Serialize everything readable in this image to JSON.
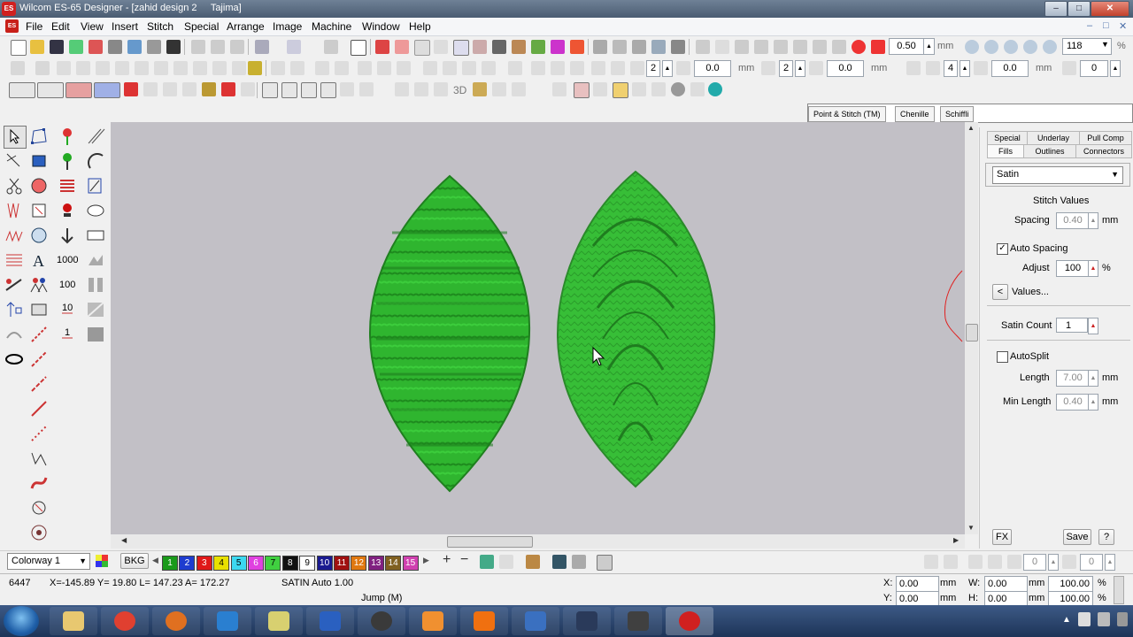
{
  "window": {
    "app_title": "Wilcom ES-65 Designer - [zahid design 2",
    "machine": "Tajima]",
    "logo": "ES"
  },
  "window_controls": [
    "–",
    "□",
    "✕"
  ],
  "mdi_controls": [
    "–",
    "□",
    "✕"
  ],
  "menu": {
    "items": [
      "File",
      "Edit",
      "View",
      "Insert",
      "Stitch",
      "Special",
      "Arrange",
      "Image",
      "Machine",
      "Window",
      "Help"
    ]
  },
  "toolbar": {
    "spacing_value": "0.50",
    "spacing_unit": "mm",
    "zoom_value": "118",
    "zoom_unit": "%",
    "row2": {
      "val_a": "2",
      "val_b": "0.0",
      "unit_b": "mm",
      "val_c": "2",
      "val_d": "0.0",
      "unit_d": "mm",
      "val_e": "4",
      "val_f": "0.0",
      "unit_f": "mm",
      "val_g": "0"
    },
    "row3_label": "3D"
  },
  "sub_tabs": [
    "Point & Stitch (TM)",
    "Chenille",
    "Schiffli"
  ],
  "toolbox": {
    "count_1000": "1000",
    "count_100": "100",
    "count_10": "10",
    "count_1": "1"
  },
  "properties": {
    "tabs_top": [
      "Special",
      "Underlay",
      "Pull Comp"
    ],
    "tabs_bottom": [
      "Fills",
      "Outlines",
      "Connectors"
    ],
    "fill_type": "Satin",
    "section_title": "Stitch Values",
    "spacing": {
      "label": "Spacing",
      "value": "0.40",
      "unit": "mm"
    },
    "auto_spacing": {
      "label": "Auto Spacing",
      "checked": true
    },
    "adjust": {
      "label": "Adjust",
      "value": "100",
      "unit": "%"
    },
    "values_button": {
      "arrow": "<",
      "label": "Values..."
    },
    "satin_count": {
      "label": "Satin Count",
      "value": "1"
    },
    "autosplit": {
      "label": "AutoSplit",
      "checked": false
    },
    "length": {
      "label": "Length",
      "value": "7.00",
      "unit": "mm"
    },
    "min_length": {
      "label": "Min Length",
      "value": "0.40",
      "unit": "mm"
    },
    "fx_button": "FX",
    "save_button": "Save",
    "help_button": "?"
  },
  "colorbar": {
    "colorway": "Colorway 1",
    "bkg_label": "BKG",
    "chips": [
      {
        "label": "1",
        "color": "#1a9a1a"
      },
      {
        "label": "2",
        "color": "#1e3ccf"
      },
      {
        "label": "3",
        "color": "#e01818"
      },
      {
        "label": "4",
        "color": "#e8e000"
      },
      {
        "label": "5",
        "color": "#3cd8f0"
      },
      {
        "label": "6",
        "color": "#e040e0"
      },
      {
        "label": "7",
        "color": "#40d040"
      },
      {
        "label": "8",
        "color": "#111111"
      },
      {
        "label": "9",
        "color": "#ffffff"
      },
      {
        "label": "10",
        "color": "#1a1a90"
      },
      {
        "label": "11",
        "color": "#a01010"
      },
      {
        "label": "12",
        "color": "#e07810"
      },
      {
        "label": "13",
        "color": "#802080"
      },
      {
        "label": "14",
        "color": "#806020"
      },
      {
        "label": "15",
        "color": "#d040b0"
      }
    ],
    "right_spin_a": "0",
    "right_spin_b": "0"
  },
  "status": {
    "stitch_count": "6447",
    "coords": "X=-145.89 Y= 19.80 L= 147.23 A= 172.27",
    "stitch_type": "SATIN Auto  1.00",
    "jump": "Jump (M)",
    "x_label": "X:",
    "x_value": "0.00",
    "y_label": "Y:",
    "y_value": "0.00",
    "w_label": "W:",
    "w_value": "0.00",
    "h_label": "H:",
    "h_value": "0.00",
    "w_pct": "100.00",
    "h_pct": "100.00",
    "unit_mm": "mm",
    "unit_pct": "%"
  },
  "taskbar": {
    "apps": [
      "explorer",
      "chrome",
      "firefox",
      "internet-explorer",
      "notes",
      "outlook",
      "media-center",
      "media-player",
      "vlc",
      "paint",
      "music",
      "studio",
      "wilcom"
    ]
  }
}
